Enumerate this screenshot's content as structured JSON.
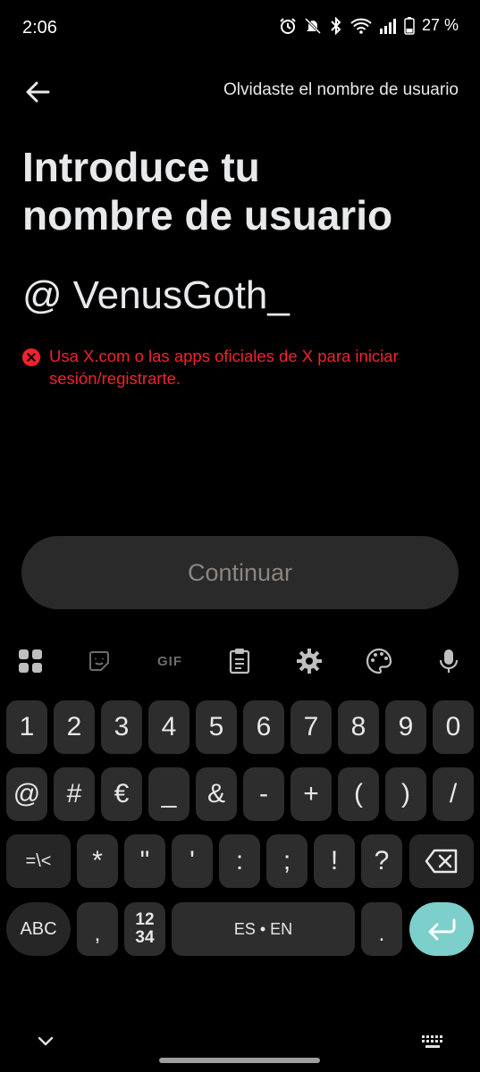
{
  "status_bar": {
    "time": "2:06",
    "battery": "27 %",
    "icons": [
      "alarm-icon",
      "mute-icon",
      "bluetooth-icon",
      "wifi-icon",
      "signal-icon",
      "battery-icon"
    ]
  },
  "header": {
    "forgot_link": "Olvidaste el nombre de usuario"
  },
  "main": {
    "title_line1": "Introduce tu",
    "title_line2": "nombre de usuario",
    "at_symbol": "@",
    "username_value": "VenusGoth_",
    "error_message": "Usa X.com o las apps oficiales de X para iniciar sesión/registrarte.",
    "continue_label": "Continuar"
  },
  "keyboard": {
    "toolbar": [
      "apps-grid-icon",
      "sticker-icon",
      "GIF",
      "clipboard-icon",
      "settings-gear-icon",
      "palette-icon",
      "microphone-icon"
    ],
    "gif_label": "GIF",
    "row1": [
      "1",
      "2",
      "3",
      "4",
      "5",
      "6",
      "7",
      "8",
      "9",
      "0"
    ],
    "row2": [
      "@",
      "#",
      "€",
      "_",
      "&",
      "-",
      "+",
      "(",
      ")",
      "/"
    ],
    "row3": [
      "=\\<",
      "*",
      "\"",
      "'",
      ":",
      ";",
      "!",
      "?"
    ],
    "abc": "ABC",
    "comma": ",",
    "numpad_top": "12",
    "numpad_bottom": "34",
    "space": "ES • EN",
    "period": "."
  },
  "colors": {
    "error": "#f4212e",
    "enter_key": "#7ccfcb",
    "continue_bg": "#2a2a2a"
  }
}
